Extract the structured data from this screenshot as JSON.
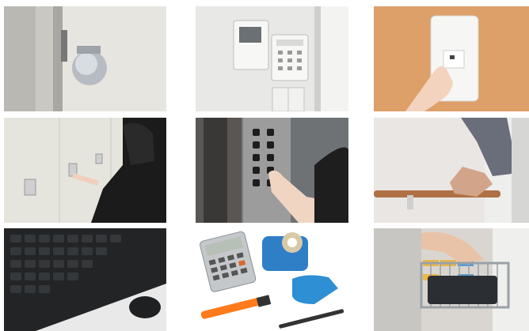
{
  "photos": [
    {
      "subject": "door-knob",
      "icon": "door-knob-icon"
    },
    {
      "subject": "intercom-panel",
      "icon": "intercom-icon"
    },
    {
      "subject": "light-switch",
      "icon": "light-switch-icon"
    },
    {
      "subject": "locker-lock",
      "icon": "locker-icon"
    },
    {
      "subject": "elevator-buttons",
      "icon": "elevator-icon"
    },
    {
      "subject": "handrail",
      "icon": "handrail-icon"
    },
    {
      "subject": "keyboard-mouse",
      "icon": "keyboard-icon"
    },
    {
      "subject": "stationery",
      "icon": "stationery-icon"
    },
    {
      "subject": "shopping-cart",
      "icon": "shopping-cart-icon"
    }
  ],
  "colors": {
    "wall_light": "#ecebe6",
    "wood": "#d9905a",
    "elevator_steel": "#8a8a8a",
    "keyboard_black": "#222426",
    "stapler_blue": "#2f8fd4"
  }
}
